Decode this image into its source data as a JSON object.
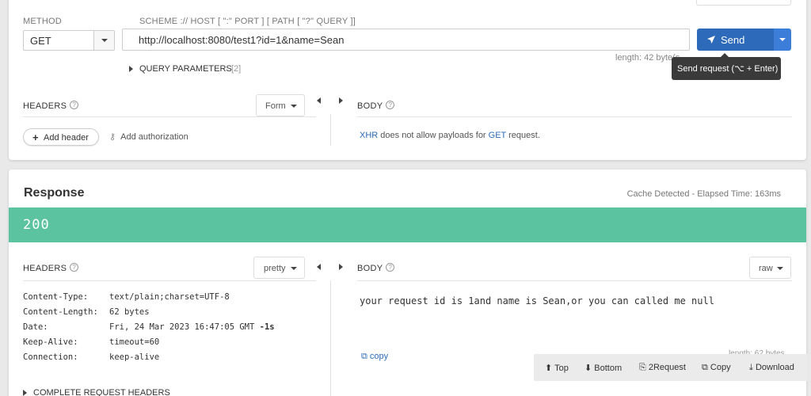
{
  "request": {
    "method_caption": "METHOD",
    "method_value": "GET",
    "url_caption": "SCHEME :// HOST [ \":\" PORT ] [ PATH [ \"?\" QUERY ]]",
    "url_value": "http://localhost:8080/test1?id=1&name=Sean",
    "length_text": "length: 42 byte(s",
    "send_label": "Send",
    "tooltip": "Send request (⌥ + Enter)",
    "query_params_label": "QUERY PARAMETERS",
    "query_params_count": "[2]",
    "headers_label": "HEADERS",
    "headers_mode": "Form",
    "add_header_label": "Add header",
    "add_auth_label": "Add authorization",
    "body_label": "BODY",
    "body_note": {
      "xhr": "XHR",
      "mid": " does not allow payloads for ",
      "method": "GET",
      "end": " request."
    }
  },
  "response": {
    "title": "Response",
    "meta": "Cache Detected - Elapsed Time: 163ms",
    "status_code": "200",
    "headers_label": "HEADERS",
    "headers_mode": "pretty",
    "body_label": "BODY",
    "body_mode": "raw",
    "headers": [
      {
        "key": "Content-Type:",
        "value": "text/plain;charset=UTF-8"
      },
      {
        "key": "Content-Length:",
        "value": "62 bytes"
      },
      {
        "key": "Date:",
        "value": "Fri, 24 Mar 2023 16:47:05 GMT",
        "suffix": "-1s"
      },
      {
        "key": "Keep-Alive:",
        "value": "timeout=60"
      },
      {
        "key": "Connection:",
        "value": "keep-alive"
      }
    ],
    "body_text": "your request id is 1and name is Sean,or you can called me null",
    "copy_label": "copy",
    "length_partial": "length: 62 bytes",
    "complete_headers_label": "COMPLETE REQUEST HEADERS"
  },
  "bottom_bar": {
    "top": "Top",
    "bottom": "Bottom",
    "to_request": "2Request",
    "copy": "Copy",
    "download": "Download"
  },
  "colors": {
    "accent": "#2d6ab9",
    "status_ok": "#5cc3a0"
  }
}
